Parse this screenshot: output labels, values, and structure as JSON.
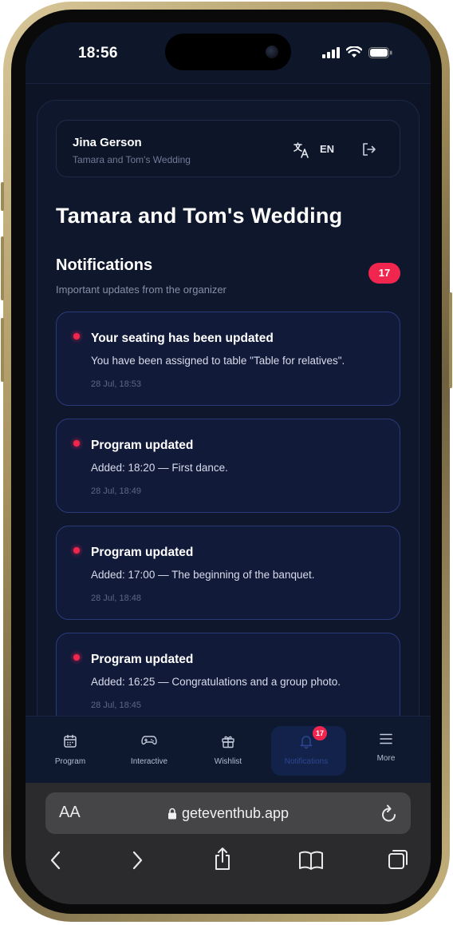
{
  "status_bar": {
    "time": "18:56"
  },
  "header": {
    "user_name": "Jina Gerson",
    "event_name": "Tamara and Tom's Wedding",
    "language_code": "EN"
  },
  "page_title": "Tamara and Tom's Wedding",
  "notifications": {
    "title": "Notifications",
    "subtitle": "Important updates from the organizer",
    "count": "17",
    "items": [
      {
        "title": "Your seating has been updated",
        "body": "You have been assigned to table \"Table for relatives\".",
        "time": "28 Jul, 18:53"
      },
      {
        "title": "Program updated",
        "body": "Added: 18:20 — First dance.",
        "time": "28 Jul, 18:49"
      },
      {
        "title": "Program updated",
        "body": "Added: 17:00 — The beginning of the banquet.",
        "time": "28 Jul, 18:48"
      },
      {
        "title": "Program updated",
        "body": "Added: 16:25 — Congratulations and a group photo.",
        "time": "28 Jul, 18:45"
      }
    ]
  },
  "tabbar": {
    "tabs": [
      {
        "label": "Program",
        "icon": "calendar-icon"
      },
      {
        "label": "Interactive",
        "icon": "gamepad-icon"
      },
      {
        "label": "Wishlist",
        "icon": "gift-icon"
      },
      {
        "label": "Notifications",
        "icon": "bell-icon",
        "active": true,
        "badge": "17"
      },
      {
        "label": "More",
        "icon": "menu-icon"
      }
    ]
  },
  "browser": {
    "text_size_label": "AA",
    "url": "geteventhub.app"
  },
  "colors": {
    "background": "#0c1426",
    "accent": "#f0264f",
    "card_border": "#2b3a78"
  }
}
